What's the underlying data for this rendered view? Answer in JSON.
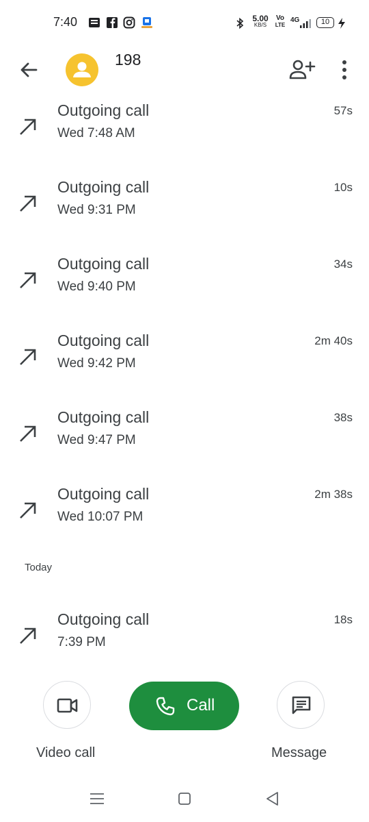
{
  "status_bar": {
    "time": "7:40",
    "speed": "5.00",
    "speed_unit": "KB/S",
    "volte_top": "Vo",
    "volte_bottom": "LTE",
    "network": "4G",
    "battery": "10"
  },
  "header": {
    "contact_name": "198"
  },
  "calls_earlier": [
    {
      "type": "Outgoing call",
      "when": "Wed 7:48 AM",
      "duration": "57s"
    },
    {
      "type": "Outgoing call",
      "when": "Wed 9:31 PM",
      "duration": "10s"
    },
    {
      "type": "Outgoing call",
      "when": "Wed 9:40 PM",
      "duration": "34s"
    },
    {
      "type": "Outgoing call",
      "when": "Wed 9:42 PM",
      "duration": "2m 40s"
    },
    {
      "type": "Outgoing call",
      "when": "Wed 9:47 PM",
      "duration": "38s"
    },
    {
      "type": "Outgoing call",
      "when": "Wed 10:07 PM",
      "duration": "2m 38s"
    }
  ],
  "section_today": "Today",
  "calls_today": [
    {
      "type": "Outgoing call",
      "when": "7:39 PM",
      "duration": "18s"
    }
  ],
  "actions": {
    "video_call_label": "Video call",
    "call_label": "Call",
    "message_label": "Message"
  },
  "colors": {
    "avatar": "#f6c32f",
    "call_button": "#1e8e3e"
  }
}
